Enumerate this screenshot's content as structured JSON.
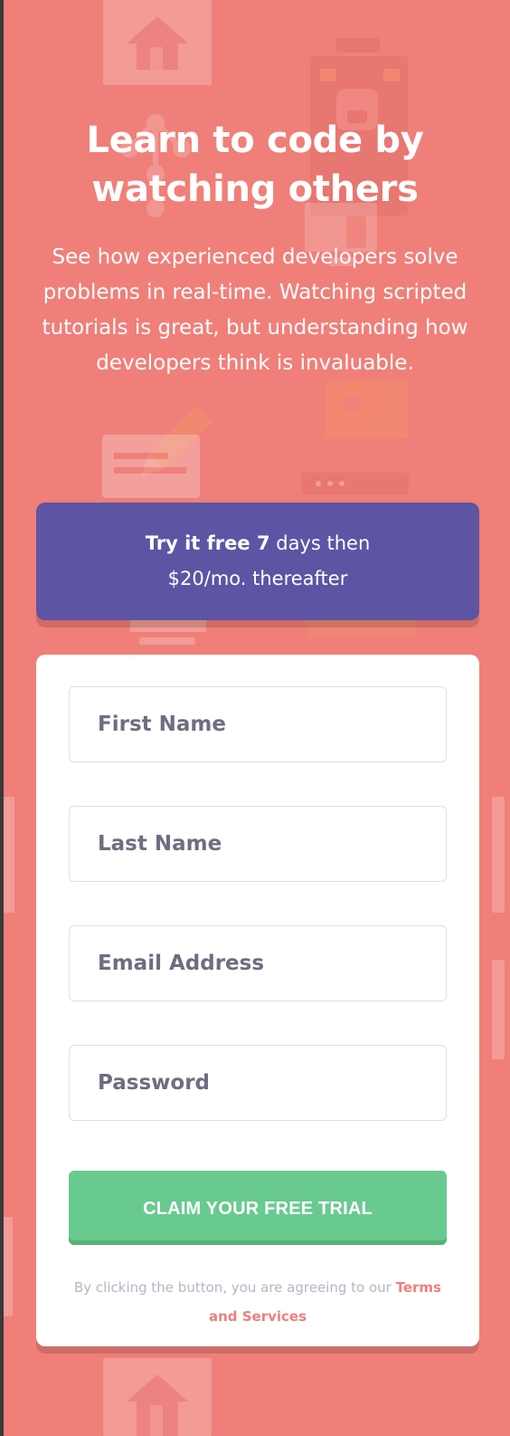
{
  "hero": {
    "title_line_1": "Learn to code by",
    "title_line_2": "watching others",
    "subtitle": "See how experienced developers solve problems in real-time. Watching scripted tutorials is great, but understanding how developers think is invaluable."
  },
  "offer": {
    "strong": "Try it free 7",
    "text_after_strong": " days then",
    "text_line_2": "$20/mo. thereafter"
  },
  "form": {
    "fields": [
      {
        "placeholder": "First Name"
      },
      {
        "placeholder": "Last Name"
      },
      {
        "placeholder": "Email Address"
      },
      {
        "placeholder": "Password"
      }
    ],
    "submit_label": "CLAIM YOUR FREE TRIAL",
    "legal_prefix": "By clicking the button, you are agreeing to our",
    "legal_link": "Terms and Services"
  },
  "colors": {
    "page_background": "#f07f79",
    "offer_background": "#5d54a4",
    "card_background": "#ffffff",
    "button_background": "#69ca8f",
    "link_color": "#f07f79",
    "placeholder_color": "#6f6d80",
    "legal_text_color": "#b7b5c7"
  },
  "icons": [
    "house-icon",
    "briefcase-icon",
    "network-icon",
    "monitor-icon",
    "gear-icon",
    "pencil-icon",
    "message-icon",
    "menu-dots-icon",
    "cart-icon"
  ]
}
